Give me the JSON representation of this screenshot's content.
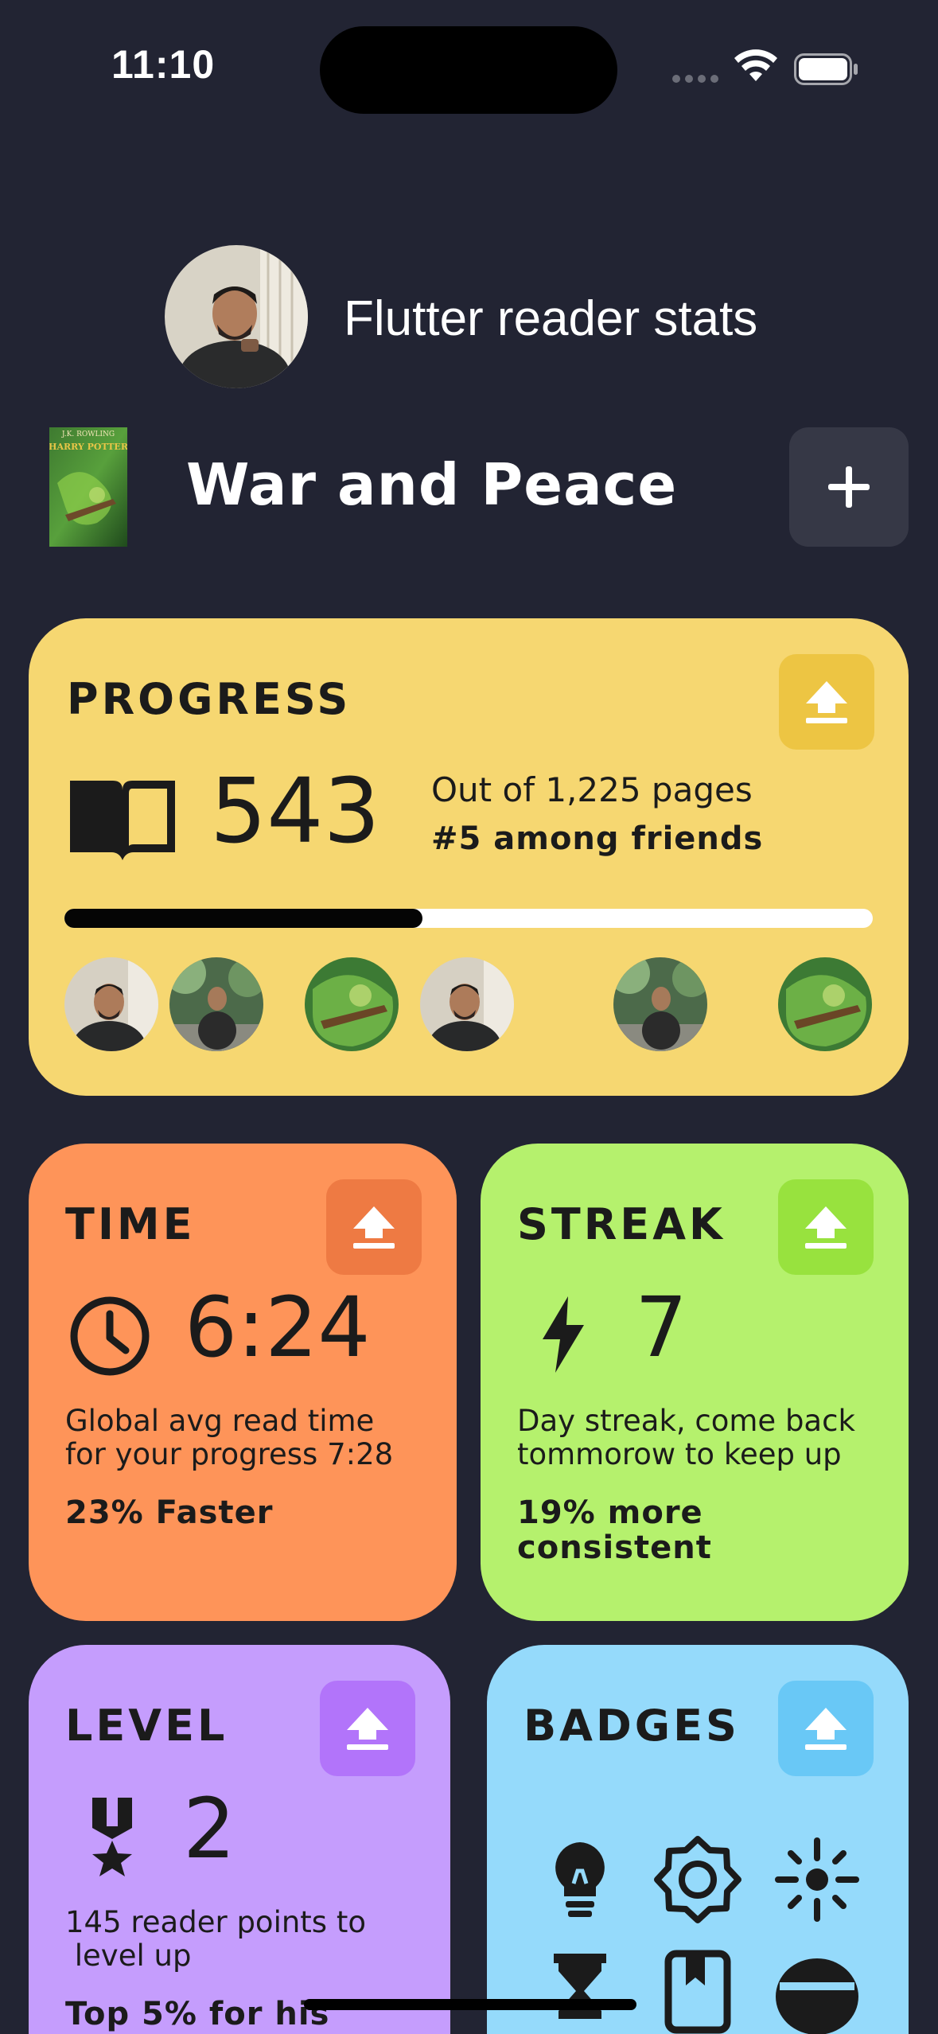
{
  "status_bar": {
    "time": "11:10"
  },
  "header": {
    "title": "Flutter reader stats"
  },
  "book": {
    "title": "War and Peace",
    "cover_author": "J.K. ROWLING",
    "cover_series": "HARRY POTTER"
  },
  "progress_card": {
    "title": "PROGRESS",
    "pages_read": "543",
    "total_text": "Out of 1,225 pages",
    "rank_text": "#5 among friends",
    "progress_fraction": 0.443,
    "friends": [
      {
        "avatar": "man-avatar"
      },
      {
        "avatar": "park-avatar"
      },
      {
        "avatar": "book-avatar"
      },
      {
        "avatar": "man-avatar"
      },
      {
        "avatar": "park-avatar"
      },
      {
        "avatar": "book-avatar"
      }
    ]
  },
  "time_card": {
    "title": "TIME",
    "value": "6:24",
    "line1": "Global avg read time",
    "line2": "for your progress 7:28",
    "highlight": "23% Faster"
  },
  "streak_card": {
    "title": "STREAK",
    "value": "7",
    "line1": "Day streak, come back",
    "line2": "tommorow to keep up",
    "highlight1": "19% more",
    "highlight2": "consistent"
  },
  "level_card": {
    "title": "LEVEL",
    "value": "2",
    "line1": "145 reader points to",
    "line2": " level up",
    "highlight": "Top 5% for his"
  },
  "badges_card": {
    "title": "BADGES",
    "badges": [
      "lightbulb-icon",
      "sun-badge-icon",
      "sparkle-icon",
      "hourglass-icon",
      "bookmark-book-icon",
      "vr-headset-icon"
    ]
  },
  "colors": {
    "background": "#222433",
    "progress": "#f6d771",
    "time": "#fe9459",
    "streak": "#b5f16d",
    "level": "#c59dfd",
    "badges": "#95dafb"
  }
}
